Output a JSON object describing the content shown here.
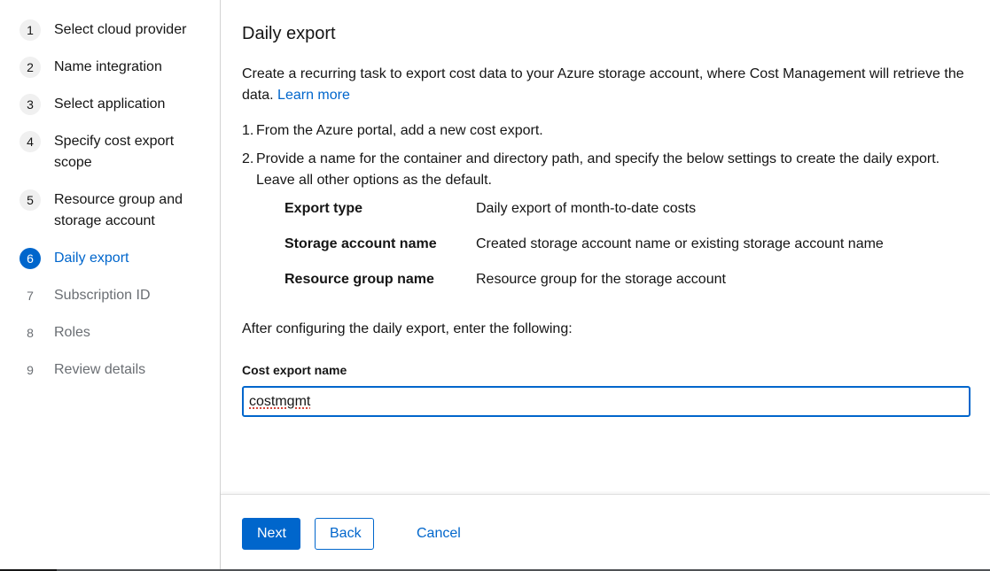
{
  "wizard_nav": {
    "items": [
      {
        "number": "1",
        "label": "Select cloud provider",
        "state": "completed"
      },
      {
        "number": "2",
        "label": "Name integration",
        "state": "completed"
      },
      {
        "number": "3",
        "label": "Select application",
        "state": "completed"
      },
      {
        "number": "4",
        "label": "Specify cost export scope",
        "state": "completed"
      },
      {
        "number": "5",
        "label": "Resource group and storage account",
        "state": "completed"
      },
      {
        "number": "6",
        "label": "Daily export",
        "state": "current"
      },
      {
        "number": "7",
        "label": "Subscription ID",
        "state": "disabled"
      },
      {
        "number": "8",
        "label": "Roles",
        "state": "disabled"
      },
      {
        "number": "9",
        "label": "Review details",
        "state": "disabled"
      }
    ]
  },
  "main": {
    "title": "Daily export",
    "description": "Create a recurring task to export cost data to your Azure storage account, where Cost Management will retrieve the data.",
    "learn_more": "Learn more",
    "steps": [
      {
        "number": "1.",
        "text": "From the Azure portal, add a new cost export."
      },
      {
        "number": "2.",
        "text": "Provide a name for the container and directory path, and specify the below settings to create the daily export. Leave all other options as the default."
      }
    ],
    "settings": [
      {
        "key": "Export type",
        "value": "Daily export of month-to-date costs"
      },
      {
        "key": "Storage account name",
        "value": "Created storage account name or existing storage account name"
      },
      {
        "key": "Resource group name",
        "value": "Resource group for the storage account"
      }
    ],
    "after_text": "After configuring the daily export, enter the following:",
    "field": {
      "label": "Cost export name",
      "value": "costmgmt"
    }
  },
  "footer": {
    "next_label": "Next",
    "back_label": "Back",
    "cancel_label": "Cancel"
  },
  "colors": {
    "accent": "#0066cc",
    "text": "#151515",
    "muted": "#6a6e73"
  }
}
